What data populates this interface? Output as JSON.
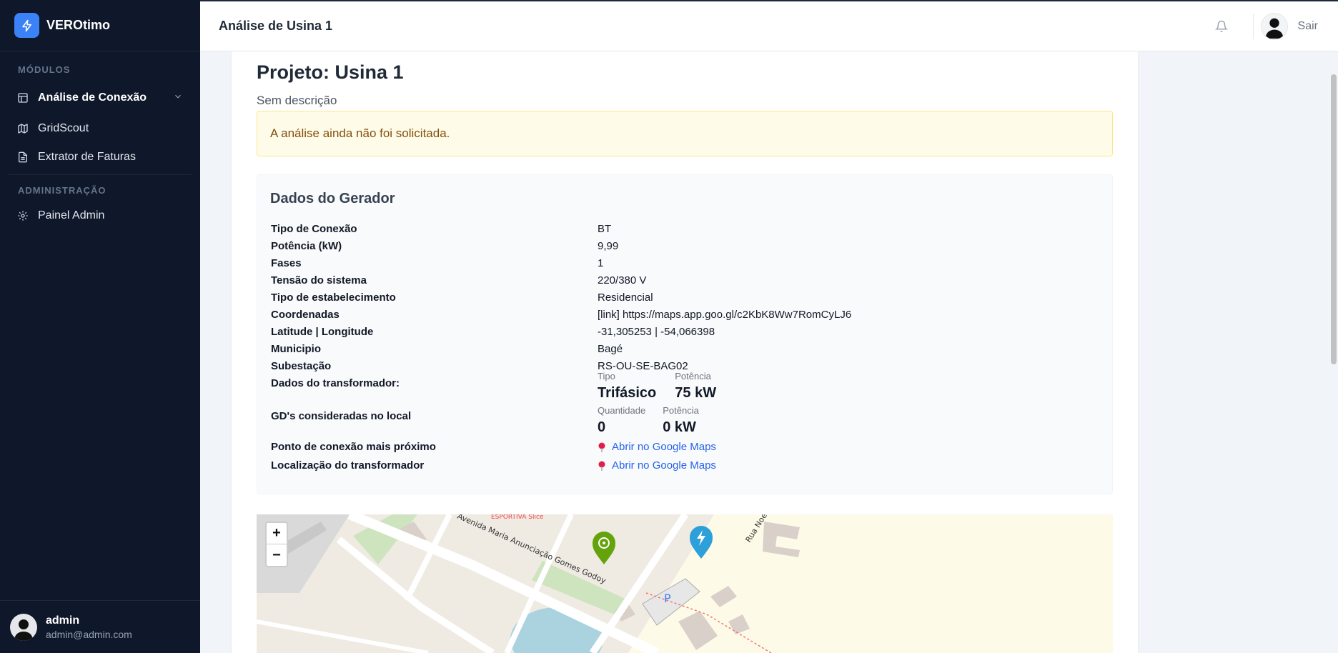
{
  "app": {
    "name": "VEROtimo"
  },
  "sidebar": {
    "section_modules": "MÓDULOS",
    "section_admin": "ADMINISTRAÇÃO",
    "items": [
      {
        "label": "Análise de Conexão",
        "icon": "table-icon"
      },
      {
        "label": "GridScout",
        "icon": "map-icon"
      },
      {
        "label": "Extrator de Faturas",
        "icon": "file-icon"
      },
      {
        "label": "Painel Admin",
        "icon": "gear-icon"
      }
    ],
    "user": {
      "name": "admin",
      "email": "admin@admin.com"
    }
  },
  "header": {
    "title": "Análise de Usina 1",
    "logout": "Sair"
  },
  "project": {
    "title": "Projeto: Usina 1",
    "description": "Sem descrição",
    "alert": "A análise ainda não foi solicitada."
  },
  "generator": {
    "title": "Dados do Gerador",
    "rows": [
      {
        "key": "Tipo de Conexão",
        "value": "BT"
      },
      {
        "key": "Potência (kW)",
        "value": "9,99"
      },
      {
        "key": "Fases",
        "value": "1"
      },
      {
        "key": "Tensão do sistema",
        "value": "220/380 V"
      },
      {
        "key": "Tipo de estabelecimento",
        "value": "Residencial"
      },
      {
        "key": "Coordenadas",
        "value": "[link] https://maps.app.goo.gl/c2KbK8Ww7RomCyLJ6"
      },
      {
        "key": "Latitude | Longitude",
        "value": "-31,305253 | -54,066398"
      },
      {
        "key": "Municipio",
        "value": "Bagé"
      },
      {
        "key": "Subestação",
        "value": "RS-OU-SE-BAG02"
      }
    ],
    "transformer": {
      "key": "Dados do transformador:",
      "type_caption": "Tipo",
      "type_value": "Trifásico",
      "power_caption": "Potência",
      "power_value": "75 kW"
    },
    "gds": {
      "key": "GD's consideradas no local",
      "qty_caption": "Quantidade",
      "qty_value": "0",
      "power_caption": "Potência",
      "power_value": "0 kW"
    },
    "nearest_point": {
      "key": "Ponto de conexão mais próximo",
      "link": "Abrir no Google Maps"
    },
    "transformer_location": {
      "key": "Localização do transformador",
      "link": "Abrir no Google Maps"
    }
  },
  "map": {
    "zoom_in": "+",
    "zoom_out": "−",
    "labels": {
      "street1": "Avenida Maria Anunciação Gomes Godoy",
      "street2": "Rua Noe",
      "poi": "ESPORTIVA Slice",
      "parking": "P"
    }
  },
  "colors": {
    "accent": "#3b82f6",
    "sidebar": "#0f172a",
    "link": "#2563eb",
    "alert_bg": "#fefce8"
  }
}
